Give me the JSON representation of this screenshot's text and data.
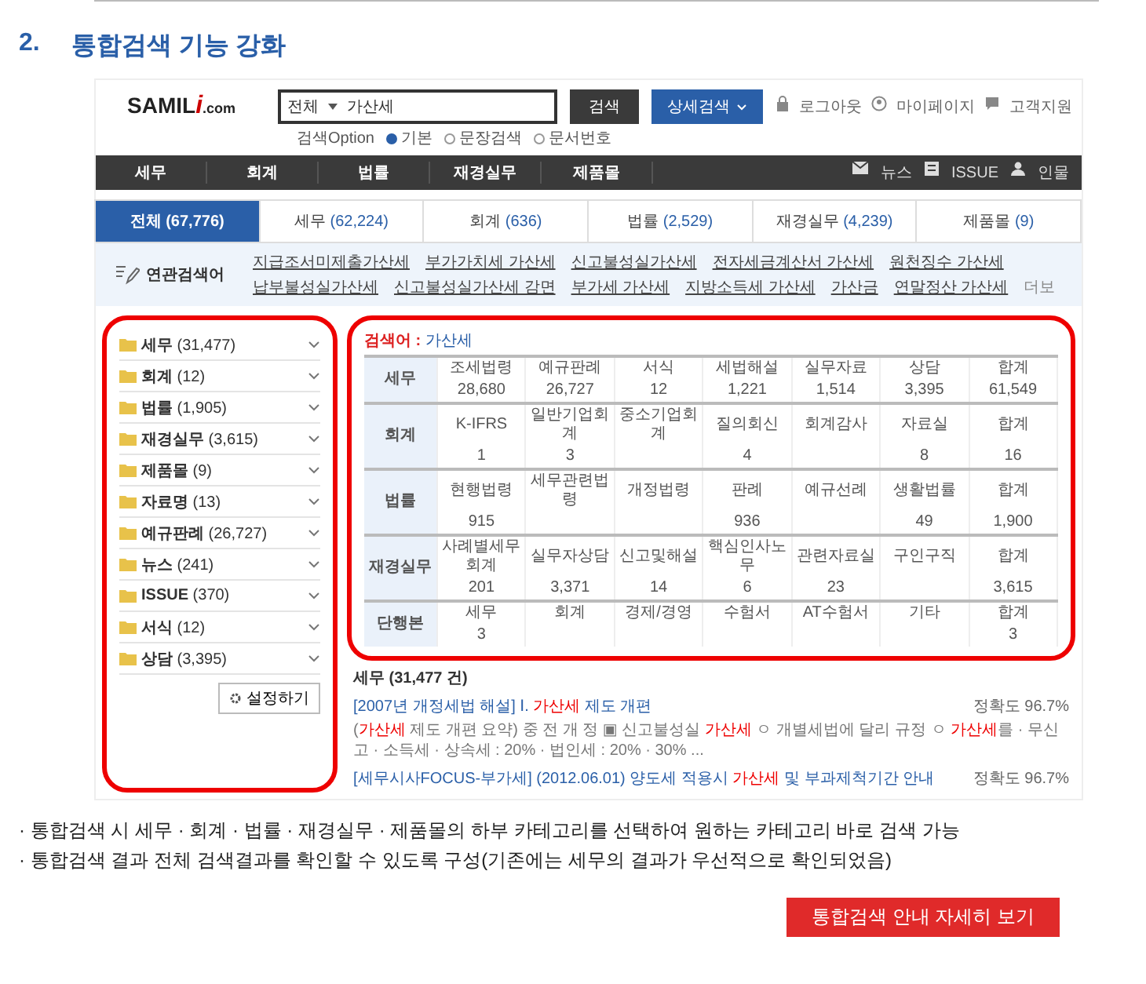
{
  "heading": {
    "number": "2.",
    "title": "통합검색 기능 강화"
  },
  "screenshot": {
    "logo": {
      "name": "SAMIL",
      "mark": "i",
      "domain": ".com"
    },
    "search": {
      "scope": "전체",
      "value": "가산세",
      "button": "검색",
      "advanced_button": "상세검색"
    },
    "top_links": [
      {
        "label": "로그아웃"
      },
      {
        "label": "마이페이지"
      },
      {
        "label": "고객지원"
      }
    ],
    "search_option": {
      "label": "검색Option",
      "options": [
        {
          "label": "기본",
          "selected": true
        },
        {
          "label": "문장검색",
          "selected": false
        },
        {
          "label": "문서번호",
          "selected": false
        }
      ]
    },
    "nav": [
      "세무",
      "회계",
      "법률",
      "재경실무",
      "제품몰"
    ],
    "nav_links": [
      {
        "label": "뉴스"
      },
      {
        "label": "ISSUE"
      },
      {
        "label": "인물"
      }
    ],
    "tabs": [
      {
        "label": "전체",
        "count": "(67,776)",
        "selected": true
      },
      {
        "label": "세무",
        "count": "(62,224)",
        "selected": false
      },
      {
        "label": "회계",
        "count": "(636)",
        "selected": false
      },
      {
        "label": "법률",
        "count": "(2,529)",
        "selected": false
      },
      {
        "label": "재경실무",
        "count": "(4,239)",
        "selected": false
      },
      {
        "label": "제품몰",
        "count": "(9)",
        "selected": false
      }
    ],
    "related": {
      "label": "연관검색어",
      "terms": [
        "지급조서미제출가산세",
        "부가가치세 가산세",
        "신고불성실가산세",
        "전자세금계산서 가산세",
        "원천징수 가산세",
        "납부불성실가산세",
        "신고불성실가산세 감면",
        "부가세 가산세",
        "지방소득세 가산세",
        "가산금",
        "연말정산 가산세"
      ],
      "more": "더보"
    },
    "sidebar": {
      "items": [
        {
          "label": "세무",
          "count": "(31,477)"
        },
        {
          "label": "회계",
          "count": "(12)"
        },
        {
          "label": "법률",
          "count": "(1,905)"
        },
        {
          "label": "재경실무",
          "count": "(3,615)"
        },
        {
          "label": "제품몰",
          "count": "(9)"
        },
        {
          "label": "자료명",
          "count": "(13)"
        },
        {
          "label": "예규판례",
          "count": "(26,727)"
        },
        {
          "label": "뉴스",
          "count": "(241)"
        },
        {
          "label": "ISSUE",
          "count": "(370)"
        },
        {
          "label": "서식",
          "count": "(12)"
        },
        {
          "label": "상담",
          "count": "(3,395)"
        }
      ],
      "settings_button": "설정하기"
    },
    "query": {
      "label": "검색어 :",
      "term": "가산세"
    },
    "table": [
      {
        "section": "세무",
        "cells": [
          {
            "label": "조세법령",
            "value": "28,680"
          },
          {
            "label": "예규판례",
            "value": "26,727"
          },
          {
            "label": "서식",
            "value": "12"
          },
          {
            "label": "세법해설",
            "value": "1,221"
          },
          {
            "label": "실무자료",
            "value": "1,514"
          },
          {
            "label": "상담",
            "value": "3,395"
          },
          {
            "label": "합계",
            "value": "61,549"
          }
        ]
      },
      {
        "section": "회계",
        "cells": [
          {
            "label": "K-IFRS",
            "value": "1"
          },
          {
            "label": "일반기업회계",
            "value": "3"
          },
          {
            "label": "중소기업회계"
          },
          {
            "label": "질의회신",
            "value": "4"
          },
          {
            "label": "회계감사"
          },
          {
            "label": "자료실",
            "value": "8"
          },
          {
            "label": "합계",
            "value": "16"
          }
        ]
      },
      {
        "section": "법률",
        "cells": [
          {
            "label": "현행법령",
            "value": "915"
          },
          {
            "label": "세무관련법령"
          },
          {
            "label": "개정법령"
          },
          {
            "label": "판례",
            "value": "936"
          },
          {
            "label": "예규선례"
          },
          {
            "label": "생활법률",
            "value": "49"
          },
          {
            "label": "합계",
            "value": "1,900"
          }
        ]
      },
      {
        "section": "재경실무",
        "cells": [
          {
            "label": "사례별세무회계",
            "value": "201"
          },
          {
            "label": "실무자상담",
            "value": "3,371"
          },
          {
            "label": "신고및해설",
            "value": "14"
          },
          {
            "label": "핵심인사노무",
            "value": "6"
          },
          {
            "label": "관련자료실",
            "value": "23"
          },
          {
            "label": "구인구직"
          },
          {
            "label": "합계",
            "value": "3,615"
          }
        ]
      },
      {
        "section": "단행본",
        "cells": [
          {
            "label": "세무",
            "value": "3"
          },
          {
            "label": "회계"
          },
          {
            "label": "경제/경영"
          },
          {
            "label": "수험서"
          },
          {
            "label": "AT수험서"
          },
          {
            "label": "기타"
          },
          {
            "label": "합계",
            "value": "3"
          }
        ]
      }
    ],
    "results": {
      "heading": "세무 (31,477 건)",
      "items": [
        {
          "title": [
            {
              "text": "[2007년 개정세법 해설] Ⅰ. ",
              "highlight": false
            },
            {
              "text": "가산세",
              "highlight": true
            },
            {
              "text": " 제도 개편",
              "highlight": false
            }
          ],
          "accuracy": "정확도 96.7%",
          "snippet": [
            {
              "text": "(",
              "highlight": false
            },
            {
              "text": "가산세",
              "highlight": true
            },
            {
              "text": " 제도 개편 요약) 중 전 개 정 ▣ 신고불성실 ",
              "highlight": false
            },
            {
              "text": "가산세",
              "highlight": true
            },
            {
              "text": " ㅇ 개별세법에 달리 규정 ㅇ ",
              "highlight": false
            },
            {
              "text": "가산세",
              "highlight": true
            },
            {
              "text": "를 · 무신고 · 소득세 · 상속세 : 20% · 법인세 : 20% · 30% ...",
              "highlight": false
            }
          ]
        },
        {
          "title": [
            {
              "text": "[세무시사FOCUS-부가세] (2012.06.01) 양도세 적용시 ",
              "highlight": false
            },
            {
              "text": "가산세",
              "highlight": true
            },
            {
              "text": " 및 부과제척기간 안내",
              "highlight": false
            }
          ],
          "accuracy": "정확도 96.7%"
        }
      ]
    }
  },
  "bullets": [
    "· 통합검색 시 세무 · 회계 · 법률 · 재경실무 · 제품몰의 하부 카테고리를 선택하여 원하는 카테고리 바로 검색 가능",
    "· 통합검색 결과 전체 검색결과를 확인할 수 있도록 구성(기존에는 세무의 결과가 우선적으로 확인되었음)"
  ],
  "detail_button": "통합검색 안내 자세히 보기"
}
